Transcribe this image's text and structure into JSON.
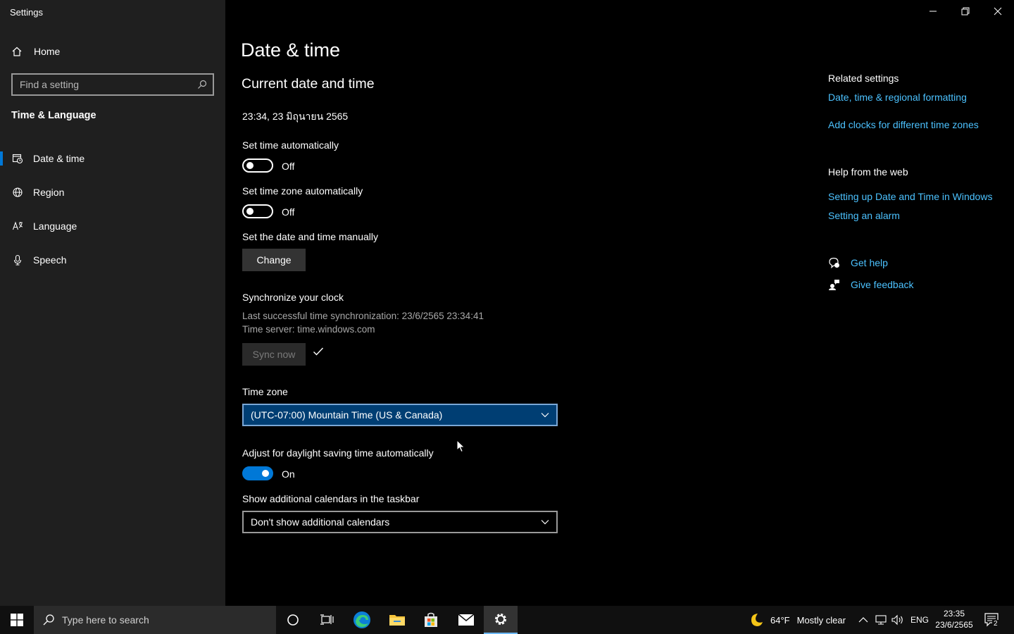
{
  "window": {
    "title": "Settings"
  },
  "sidebar": {
    "home_label": "Home",
    "search_placeholder": "Find a setting",
    "section_label": "Time & Language",
    "items": [
      {
        "label": "Date & time",
        "icon": "calendar-clock-icon",
        "active": true
      },
      {
        "label": "Region",
        "icon": "globe-icon",
        "active": false
      },
      {
        "label": "Language",
        "icon": "language-icon",
        "active": false
      },
      {
        "label": "Speech",
        "icon": "microphone-icon",
        "active": false
      }
    ]
  },
  "main": {
    "page_title": "Date & time",
    "section_title": "Current date and time",
    "current_datetime": "23:34, 23 มิถุนายน 2565",
    "set_time_auto": {
      "label": "Set time automatically",
      "state": "Off"
    },
    "set_timezone_auto": {
      "label": "Set time zone automatically",
      "state": "Off"
    },
    "manual": {
      "label": "Set the date and time manually",
      "button": "Change"
    },
    "sync": {
      "heading": "Synchronize your clock",
      "last_sync": "Last successful time synchronization: 23/6/2565 23:34:41",
      "server": "Time server: time.windows.com",
      "button": "Sync now"
    },
    "timezone": {
      "label": "Time zone",
      "value": "(UTC-07:00) Mountain Time (US & Canada)"
    },
    "dst": {
      "label": "Adjust for daylight saving time automatically",
      "state": "On"
    },
    "calendars": {
      "label": "Show additional calendars in the taskbar",
      "value": "Don't show additional calendars"
    }
  },
  "related": {
    "heading": "Related settings",
    "links": [
      "Date, time & regional formatting",
      "Add clocks for different time zones"
    ]
  },
  "help_web": {
    "heading": "Help from the web",
    "links": [
      "Setting up Date and Time in Windows",
      "Setting an alarm"
    ]
  },
  "support": {
    "get_help": "Get help",
    "give_feedback": "Give feedback"
  },
  "taskbar": {
    "search_placeholder": "Type here to search",
    "weather": {
      "temp": "64°F",
      "condition": "Mostly clear"
    },
    "language": "ENG",
    "time": "23:35",
    "date": "23/6/2565",
    "notification_count": "2"
  },
  "colors": {
    "accent": "#0078d7",
    "link": "#4cc2ff",
    "sidebar_bg": "#1f1f1f"
  }
}
